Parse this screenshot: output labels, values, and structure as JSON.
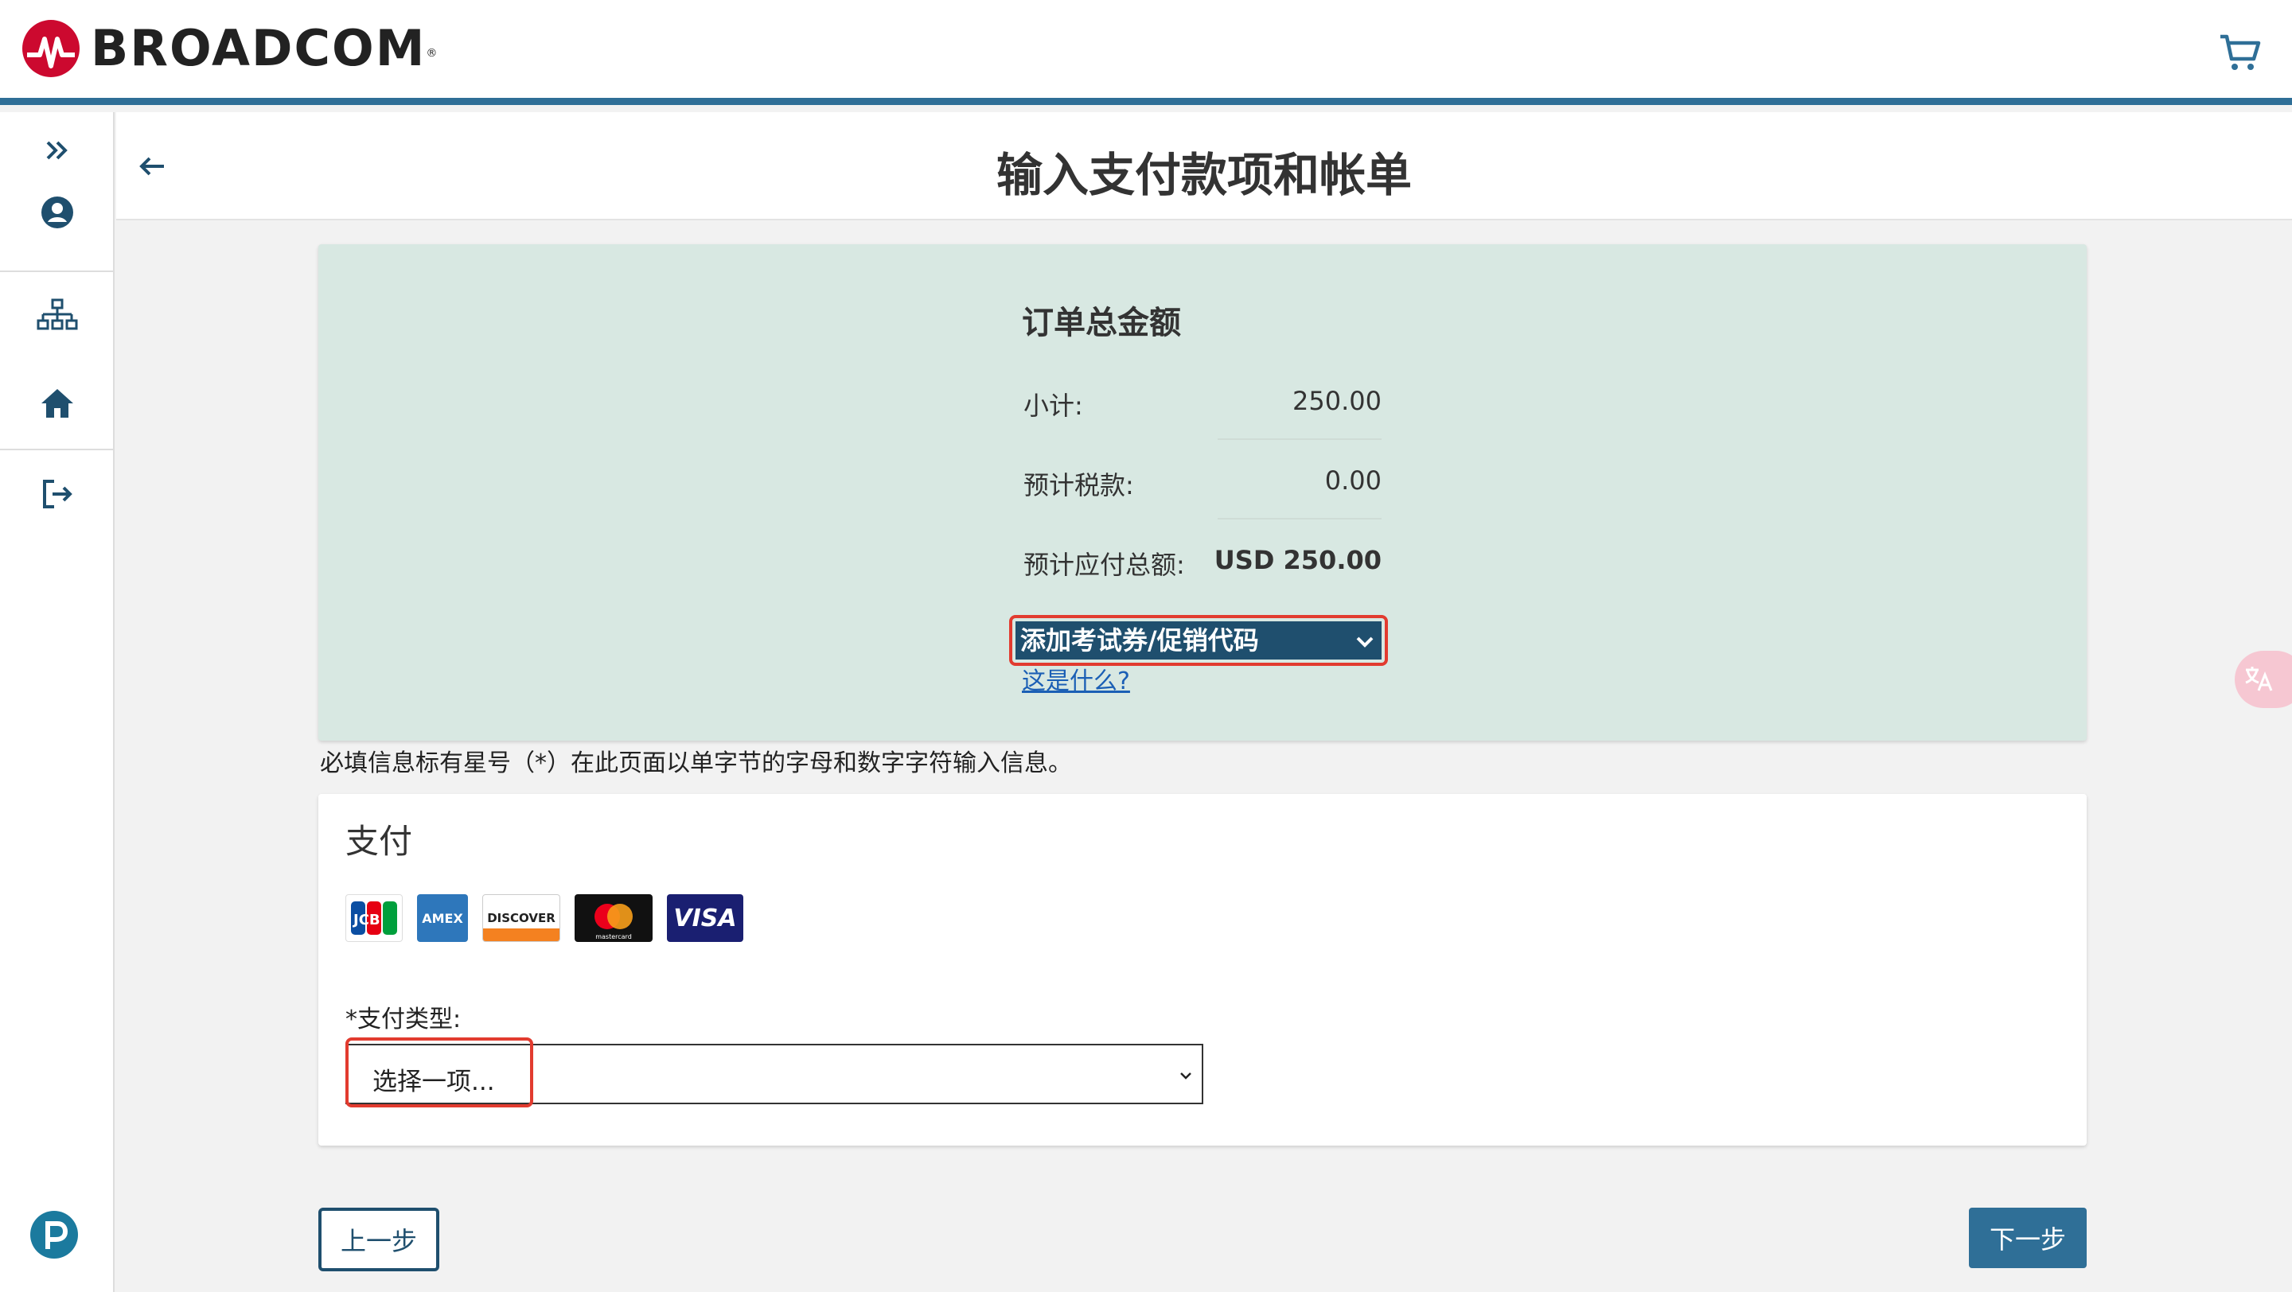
{
  "header": {
    "brand": "BROADCOM",
    "brand_mark": "®",
    "cart_icon": "cart-icon"
  },
  "sidebar": {
    "items": [
      {
        "icon": "expand-icon"
      },
      {
        "icon": "user-icon"
      },
      {
        "icon": "org-chart-icon"
      },
      {
        "icon": "home-icon"
      },
      {
        "icon": "logout-icon"
      }
    ],
    "help_icon": "help-icon"
  },
  "page": {
    "title": "输入支付款项和帐单"
  },
  "summary": {
    "title": "订单总金额",
    "subtotal_label": "小计:",
    "subtotal_value": "250.00",
    "tax_label": "预计税款:",
    "tax_value": "0.00",
    "total_label": "预计应付总额:",
    "total_value": "USD 250.00",
    "promo_label": "添加考试券/促销代码",
    "whatis_link": "这是什么?"
  },
  "required_note": "必填信息标有星号（*）在此页面以单字节的字母和数字字符输入信息。",
  "payment": {
    "title": "支付",
    "cards": [
      "JCB",
      "AMEX",
      "DISCOVER",
      "mastercard",
      "VISA"
    ],
    "type_label": "*支付类型:",
    "select_value": "选择一项..."
  },
  "buttons": {
    "prev": "上一步",
    "next": "下一步"
  },
  "colors": {
    "brand_red": "#cc092f",
    "header_border": "#2f6f97",
    "promo_bg": "#1f4f6e",
    "panel_bg": "#d8e8e2",
    "highlight": "#e23b2f"
  }
}
